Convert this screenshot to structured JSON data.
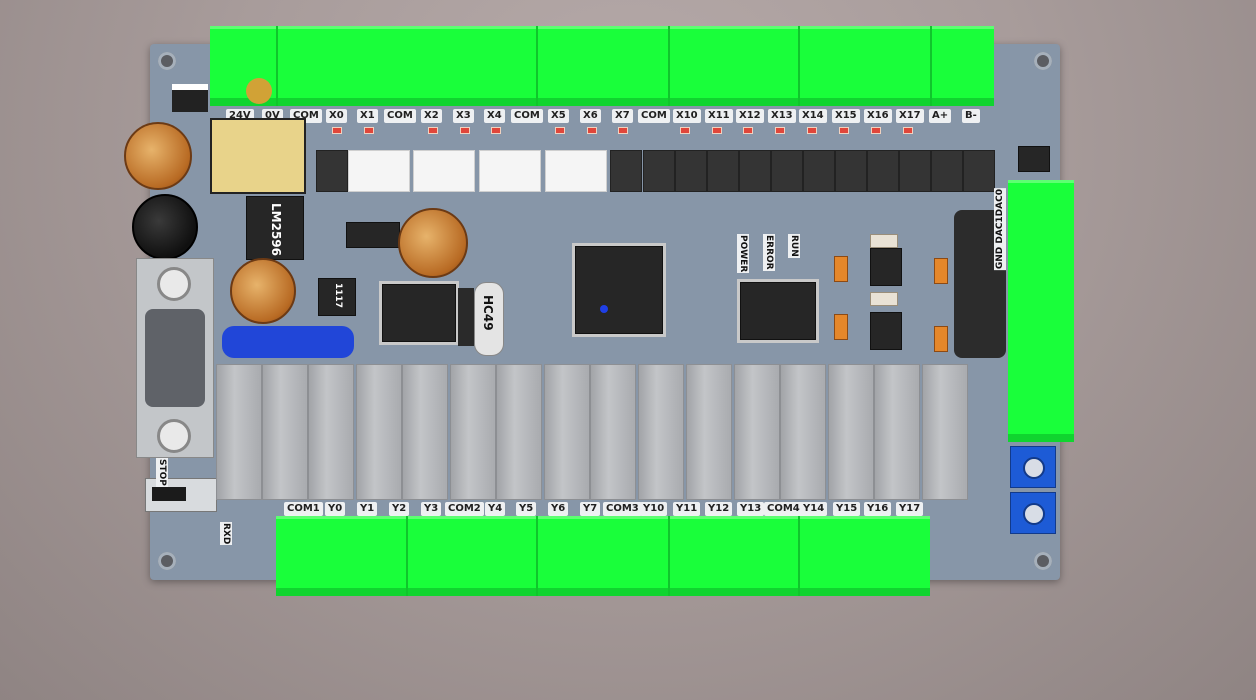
{
  "board": {
    "top_labels": [
      "24V",
      "0V",
      "COM",
      "X0",
      "X1",
      "COM",
      "X2",
      "X3",
      "X4",
      "COM",
      "X5",
      "X6",
      "X7",
      "COM",
      "X10",
      "X11",
      "X12",
      "X13",
      "X14",
      "X15",
      "X16",
      "X17",
      "A+",
      "B-"
    ],
    "bottom_labels": [
      "COM1",
      "Y0",
      "Y1",
      "Y2",
      "Y3",
      "COM2",
      "Y4",
      "Y5",
      "Y6",
      "Y7",
      "COM3",
      "Y10",
      "Y11",
      "Y12",
      "Y13",
      "COM4",
      "Y14",
      "Y15",
      "Y16",
      "Y17"
    ],
    "right_label": "GND DAC1DAC0",
    "components": {
      "regulator": "LM2596",
      "ldo": "1117",
      "crystal": "HC49",
      "power_led": "POWER",
      "error_led": "ERROR",
      "run_led": "RUN",
      "stop_label": "STOP",
      "rxd_label": "RXD"
    },
    "colors": {
      "pcb": "#8796a8",
      "terminal": "#19ff3a",
      "relay": "#b7b9bc"
    }
  }
}
